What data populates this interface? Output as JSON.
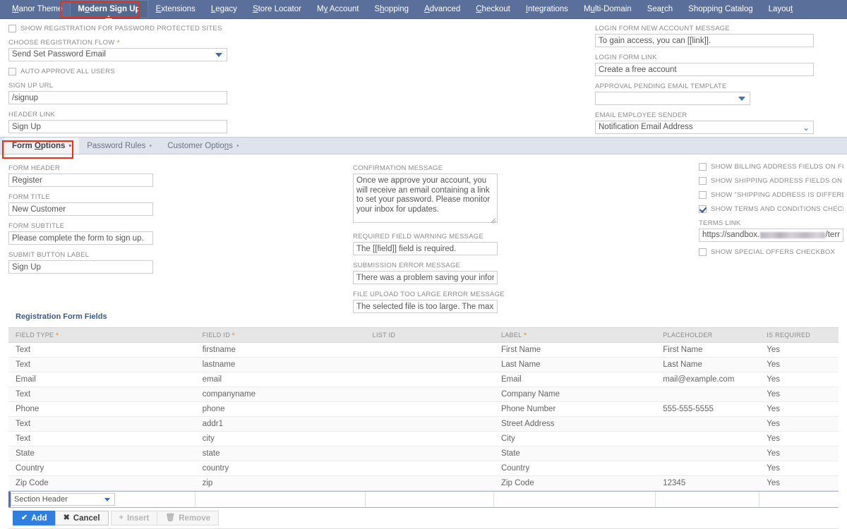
{
  "navbar": {
    "items": [
      {
        "label": "Manor Theme",
        "accel": "M",
        "active": false
      },
      {
        "label": "Modern Sign Up",
        "accel": "o",
        "active": true
      },
      {
        "label": "Extensions",
        "accel": "E",
        "active": false
      },
      {
        "label": "Legacy",
        "accel": "L",
        "active": false
      },
      {
        "label": "Store Locator",
        "accel": "S",
        "active": false
      },
      {
        "label": "My Account",
        "accel": "y",
        "active": false
      },
      {
        "label": "Shopping",
        "accel": "h",
        "active": false
      },
      {
        "label": "Advanced",
        "accel": "A",
        "active": false
      },
      {
        "label": "Checkout",
        "accel": "C",
        "active": false
      },
      {
        "label": "Integrations",
        "accel": "I",
        "active": false
      },
      {
        "label": "Multi-Domain",
        "accel": "u",
        "active": false
      },
      {
        "label": "Search",
        "accel": "r",
        "active": false
      },
      {
        "label": "Shopping Catalog",
        "accel": "",
        "active": false
      },
      {
        "label": "Layout",
        "accel": "t",
        "active": false
      }
    ]
  },
  "top_section": {
    "left": {
      "show_registration_checkbox": {
        "label": "SHOW REGISTRATION FOR PASSWORD PROTECTED SITES",
        "checked": false
      },
      "registration_flow": {
        "label": "CHOOSE REGISTRATION FLOW",
        "required": true,
        "value": "Send Set Password Email"
      },
      "auto_approve_checkbox": {
        "label": "AUTO APPROVE ALL USERS",
        "checked": false
      },
      "signup_url": {
        "label": "SIGN UP URL",
        "value": "/signup"
      },
      "header_link": {
        "label": "HEADER LINK",
        "value": "Sign Up"
      }
    },
    "right": {
      "login_new_account_message": {
        "label": "LOGIN FORM NEW ACCOUNT MESSAGE",
        "value": "To gain access, you can [[link]]."
      },
      "login_form_link": {
        "label": "LOGIN FORM LINK",
        "value": "Create a free account"
      },
      "approval_pending_email_template": {
        "label": "APPROVAL PENDING EMAIL TEMPLATE",
        "value": ""
      },
      "email_employee_sender": {
        "label": "EMAIL EMPLOYEE SENDER",
        "value": "Notification Email Address"
      }
    }
  },
  "tabs": [
    {
      "label": "Form Options",
      "accel": "O",
      "active": true
    },
    {
      "label": "Password Rules",
      "accel": "",
      "active": false
    },
    {
      "label": "Customer Options",
      "accel": "n",
      "active": false
    }
  ],
  "form_options": {
    "left": {
      "form_header": {
        "label": "FORM HEADER",
        "value": "Register"
      },
      "form_title": {
        "label": "FORM TITLE",
        "value": "New Customer"
      },
      "form_subtitle": {
        "label": "FORM SUBTITLE",
        "value": "Please complete the form to sign up."
      },
      "submit_button_label": {
        "label": "SUBMIT BUTTON LABEL",
        "value": "Sign Up"
      }
    },
    "middle": {
      "confirmation_message": {
        "label": "CONFIRMATION MESSAGE",
        "value": "Once we approve your account, you will receive an email containing a link to set your password. Please monitor your inbox for updates."
      },
      "required_field_warning": {
        "label": "REQUIRED FIELD WARNING MESSAGE",
        "value": "The [[field]] field is required."
      },
      "submission_error": {
        "label": "SUBMISSION ERROR MESSAGE",
        "value": "There was a problem saving your information"
      },
      "file_upload_too_large": {
        "label": "FILE UPLOAD TOO LARGE ERROR MESSAGE",
        "value": "The selected file is too large. The maximum fi"
      }
    },
    "right": {
      "show_billing_address": {
        "label": "SHOW BILLING ADDRESS FIELDS ON FORM",
        "checked": false
      },
      "show_shipping_address": {
        "label": "SHOW SHIPPING ADDRESS FIELDS ON FORM",
        "checked": false
      },
      "show_shipping_different": {
        "label": "SHOW \"SHIPPING ADDRESS IS DIFFERENT FROM",
        "checked": false
      },
      "show_terms_checkbox": {
        "label": "SHOW TERMS AND CONDITIONS CHECKBOX",
        "checked": true
      },
      "terms_link": {
        "label": "TERMS LINK",
        "prefix": "https://sandbox.",
        "redacted": true,
        "suffix": "/terr"
      },
      "show_special_offers": {
        "label": "SHOW SPECIAL OFFERS CHECKBOX",
        "checked": false
      }
    }
  },
  "grid": {
    "title": "Registration Form Fields",
    "columns": [
      {
        "label": "FIELD TYPE",
        "required": true
      },
      {
        "label": "FIELD ID",
        "required": true
      },
      {
        "label": "LIST ID",
        "required": false
      },
      {
        "label": "LABEL",
        "required": true
      },
      {
        "label": "PLACEHOLDER",
        "required": false
      },
      {
        "label": "IS REQUIRED",
        "required": false
      }
    ],
    "rows": [
      {
        "field_type": "Text",
        "field_id": "firstname",
        "list_id": "",
        "label": "First Name",
        "placeholder": "First Name",
        "is_required": "Yes"
      },
      {
        "field_type": "Text",
        "field_id": "lastname",
        "list_id": "",
        "label": "Last Name",
        "placeholder": "Last Name",
        "is_required": "Yes"
      },
      {
        "field_type": "Email",
        "field_id": "email",
        "list_id": "",
        "label": "Email",
        "placeholder": "mail@example.com",
        "is_required": "Yes"
      },
      {
        "field_type": "Text",
        "field_id": "companyname",
        "list_id": "",
        "label": "Company Name",
        "placeholder": "",
        "is_required": "Yes"
      },
      {
        "field_type": "Phone",
        "field_id": "phone",
        "list_id": "",
        "label": "Phone Number",
        "placeholder": "555-555-5555",
        "is_required": "Yes"
      },
      {
        "field_type": "Text",
        "field_id": "addr1",
        "list_id": "",
        "label": "Street Address",
        "placeholder": "",
        "is_required": "Yes"
      },
      {
        "field_type": "Text",
        "field_id": "city",
        "list_id": "",
        "label": "City",
        "placeholder": "",
        "is_required": "Yes"
      },
      {
        "field_type": "State",
        "field_id": "state",
        "list_id": "",
        "label": "State",
        "placeholder": "",
        "is_required": "Yes"
      },
      {
        "field_type": "Country",
        "field_id": "country",
        "list_id": "",
        "label": "Country",
        "placeholder": "",
        "is_required": "Yes"
      },
      {
        "field_type": "Zip Code",
        "field_id": "zip",
        "list_id": "",
        "label": "Zip Code",
        "placeholder": "12345",
        "is_required": "Yes"
      }
    ],
    "edit_row": {
      "field_type_value": "Section Header"
    }
  },
  "buttons": {
    "add": {
      "label": "Add",
      "icon": "check-icon",
      "disabled": false
    },
    "cancel": {
      "label": "Cancel",
      "icon": "x-icon",
      "disabled": false
    },
    "insert": {
      "label": "Insert",
      "icon": "plus-icon",
      "disabled": true
    },
    "remove": {
      "label": "Remove",
      "icon": "trash-icon",
      "disabled": true
    }
  },
  "colors": {
    "nav_bg": "#5a6f9a",
    "highlight": "#f02d11",
    "accent_blue": "#2f7fe0",
    "tabbar_bg": "#dee3ec",
    "grid_header_bg": "#e6e6e6",
    "required_star": "#d9913a"
  }
}
